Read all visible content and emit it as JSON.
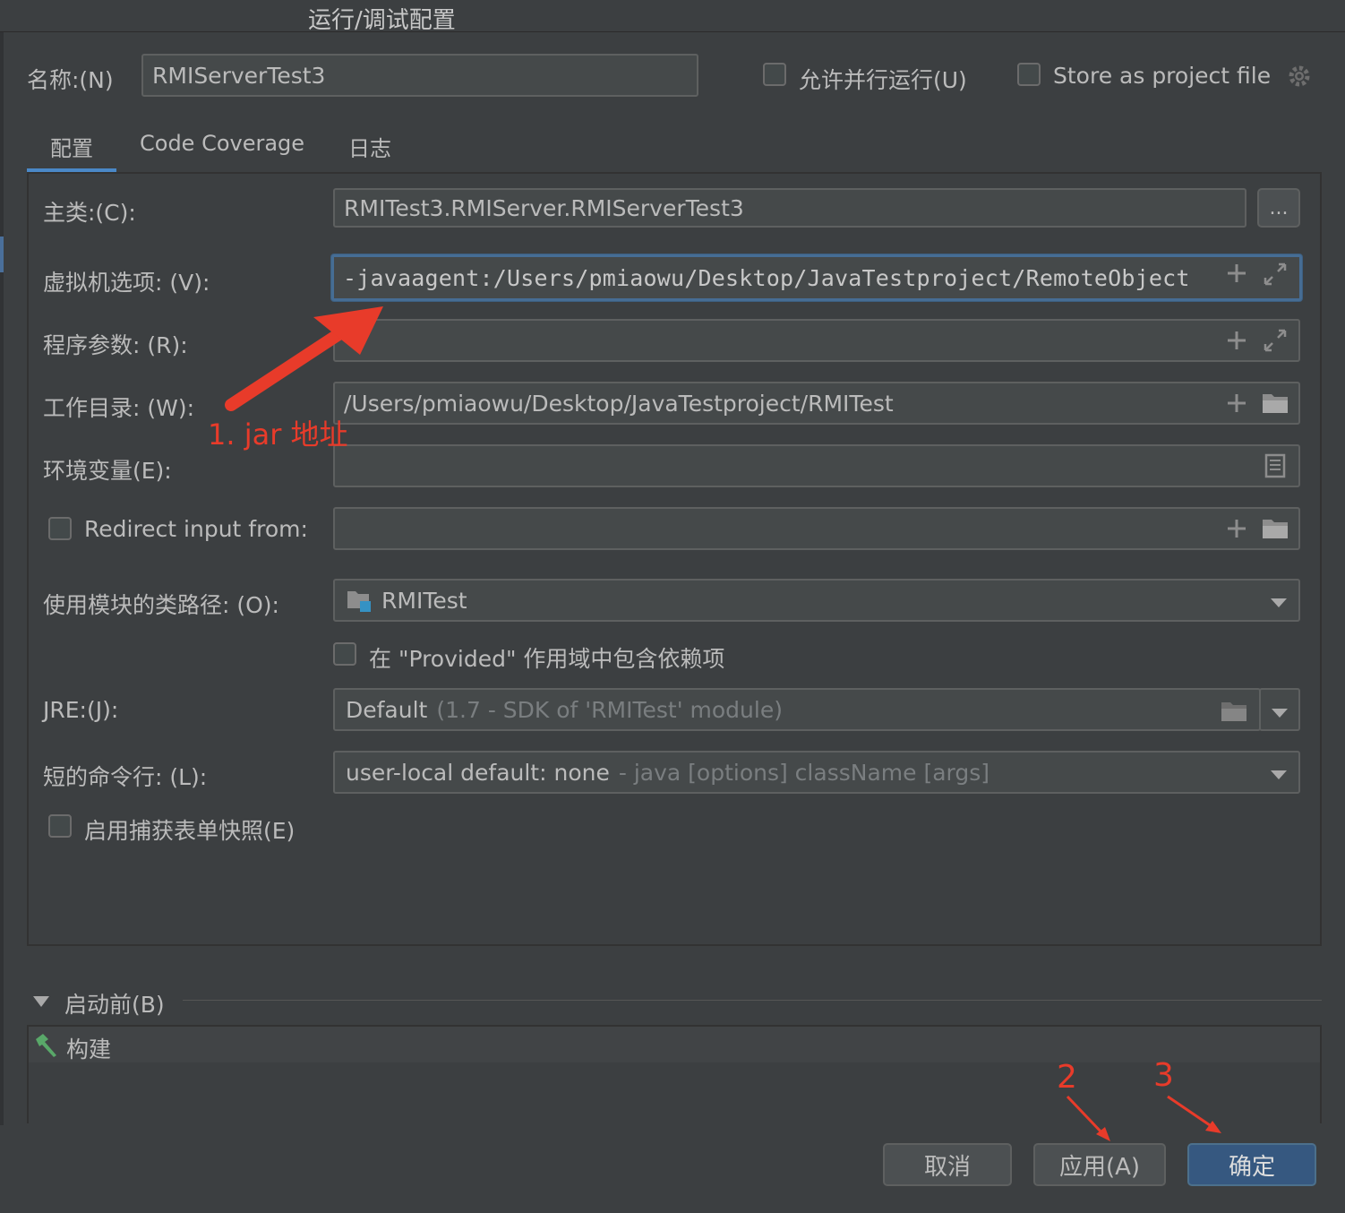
{
  "window": {
    "title": "运行/调试配置"
  },
  "header": {
    "name_label": "名称:(N)",
    "name_value": "RMIServerTest3",
    "parallel_label": "允许并行运行(U)",
    "store_label": "Store as project file"
  },
  "tabs": [
    "配置",
    "Code Coverage",
    "日志"
  ],
  "form": {
    "main_class_label": "主类:(C):",
    "main_class_value": "RMITest3.RMIServer.RMIServerTest3",
    "browse_label": "...",
    "vm_label": "虚拟机选项: (V):",
    "vm_value": "-javaagent:/Users/pmiaowu/Desktop/JavaTestproject/RemoteObject",
    "args_label": "程序参数: (R):",
    "args_value": "",
    "workdir_label": "工作目录: (W):",
    "workdir_value": "/Users/pmiaowu/Desktop/JavaTestproject/RMITest",
    "env_label": "环境变量(E):",
    "env_value": "",
    "redirect_label": "Redirect input from:",
    "redirect_value": "",
    "module_label": "使用模块的类路径: (O):",
    "module_value": "RMITest",
    "provided_label": "在 \"Provided\" 作用域中包含依赖项",
    "jre_label": "JRE:(J):",
    "jre_value": "Default",
    "jre_hint": "(1.7 - SDK of 'RMITest' module)",
    "shortcmd_label": "短的命令行: (L):",
    "shortcmd_value": "user-local default: none",
    "shortcmd_hint": "- java [options] className [args]",
    "snapshot_label": "启用捕获表单快照(E)"
  },
  "before_launch": {
    "label": "启动前(B)",
    "items": [
      "构建"
    ]
  },
  "buttons": {
    "cancel": "取消",
    "apply": "应用(A)",
    "ok": "确定"
  },
  "annotations": {
    "jar": "1. jar 地址",
    "step2": "2",
    "step3": "3"
  },
  "colors": {
    "accent": "#4a88c7",
    "annotation": "#e83b2a",
    "primary_button": "#365880"
  }
}
